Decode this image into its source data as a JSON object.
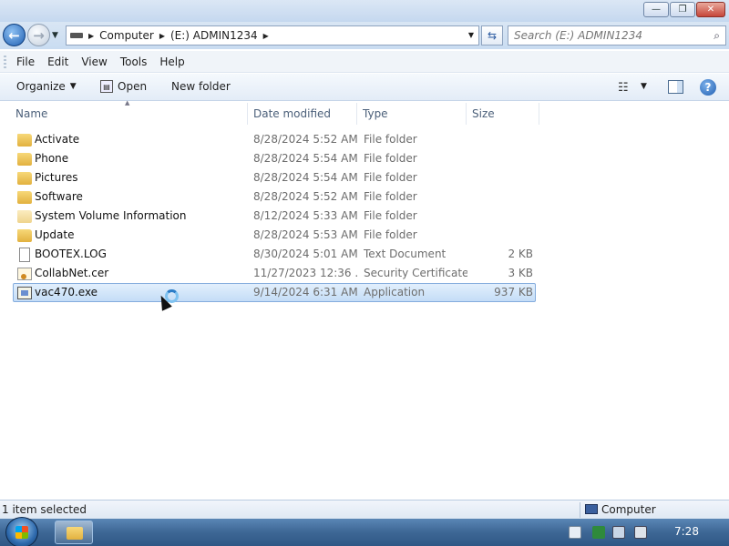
{
  "window": {
    "minimize_glyph": "—",
    "maximize_glyph": "❐",
    "close_glyph": "✕"
  },
  "address": {
    "crumbs": [
      "Computer",
      "(E:) ADMIN1234"
    ],
    "search_placeholder": "Search (E:) ADMIN1234"
  },
  "menu": [
    "File",
    "Edit",
    "View",
    "Tools",
    "Help"
  ],
  "toolbar": {
    "organize": "Organize",
    "open": "Open",
    "new_folder": "New folder"
  },
  "columns": {
    "name": "Name",
    "date_modified": "Date modified",
    "type": "Type",
    "size": "Size"
  },
  "files": [
    {
      "name": "Activate",
      "date": "8/28/2024 5:52 AM",
      "type": "File folder",
      "size": "",
      "icon": "folder-icon"
    },
    {
      "name": "Phone",
      "date": "8/28/2024 5:54 AM",
      "type": "File folder",
      "size": "",
      "icon": "folder-icon"
    },
    {
      "name": "Pictures",
      "date": "8/28/2024 5:54 AM",
      "type": "File folder",
      "size": "",
      "icon": "folder-icon"
    },
    {
      "name": "Software",
      "date": "8/28/2024 5:52 AM",
      "type": "File folder",
      "size": "",
      "icon": "folder-icon"
    },
    {
      "name": "System Volume Information",
      "date": "8/12/2024 5:33 AM",
      "type": "File folder",
      "size": "",
      "icon": "folder-icon"
    },
    {
      "name": "Update",
      "date": "8/28/2024 5:53 AM",
      "type": "File folder",
      "size": "",
      "icon": "folder-icon"
    },
    {
      "name": "BOOTEX.LOG",
      "date": "8/30/2024 5:01 AM",
      "type": "Text Document",
      "size": "2 KB",
      "icon": "text-document-icon"
    },
    {
      "name": "CollabNet.cer",
      "date": "11/27/2023 12:36 ...",
      "type": "Security Certificate",
      "size": "3 KB",
      "icon": "certificate-icon"
    },
    {
      "name": "vac470.exe",
      "date": "9/14/2024 6:31 AM",
      "type": "Application",
      "size": "937 KB",
      "icon": "application-icon",
      "selected": true
    }
  ],
  "status": {
    "selection": "1 item selected",
    "location": "Computer"
  },
  "taskbar": {
    "clock": "7:28"
  }
}
